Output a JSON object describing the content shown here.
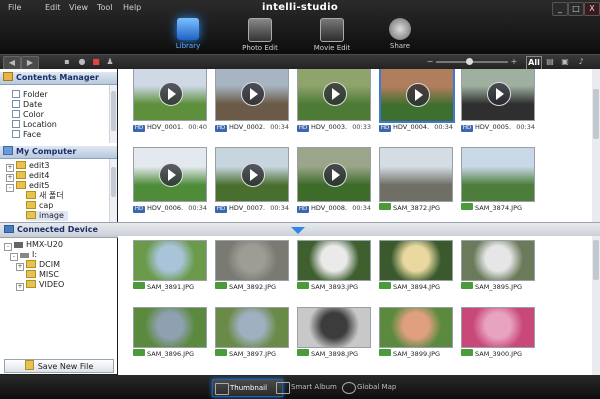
{
  "window": {
    "title": "intelli-studio",
    "min_label": "_",
    "max_label": "□",
    "close_label": "X"
  },
  "menu": [
    "File",
    "Edit",
    "View",
    "Tool",
    "Help"
  ],
  "modes": [
    {
      "label": "Library",
      "icon": "library-icon",
      "active": true
    },
    {
      "label": "Photo Edit",
      "icon": "photo-edit-icon",
      "active": false
    },
    {
      "label": "Movie Edit",
      "icon": "movie-edit-icon",
      "active": false
    },
    {
      "label": "Share",
      "icon": "share-globe-icon",
      "active": false
    }
  ],
  "toolbar": {
    "back": "◀",
    "forward": "▶",
    "zoom_minus": "−",
    "zoom_plus": "+",
    "view_all": "All"
  },
  "contents_manager": {
    "title": "Contents Manager",
    "items": [
      "Folder",
      "Date",
      "Color",
      "Location",
      "Face"
    ]
  },
  "my_computer": {
    "title": "My Computer",
    "items": [
      {
        "label": "edit3",
        "level": 1,
        "exp": "+"
      },
      {
        "label": "edit4",
        "level": 1,
        "exp": "+"
      },
      {
        "label": "edit5",
        "level": 1,
        "exp": "-"
      },
      {
        "label": "새 폴더",
        "level": 2,
        "exp": ""
      },
      {
        "label": "cap",
        "level": 2,
        "exp": ""
      },
      {
        "label": "image",
        "level": 2,
        "exp": ""
      }
    ]
  },
  "connected_device": {
    "title": "Connected Device",
    "items": [
      {
        "label": "HMX-U20",
        "level": 0,
        "exp": "-"
      },
      {
        "label": "I:",
        "level": 1,
        "exp": "-"
      },
      {
        "label": "DCIM",
        "level": 2,
        "exp": "+"
      },
      {
        "label": "MISC",
        "level": 2,
        "exp": ""
      },
      {
        "label": "VIDEO",
        "level": 2,
        "exp": "+"
      }
    ]
  },
  "save_new_file": "Save New File",
  "top_grid": [
    {
      "name": "HDV_0001.",
      "dur": "00:40",
      "type": "HD",
      "video": true,
      "sel": false,
      "c1": "#5e8f3c",
      "c2": "#cfd9e6"
    },
    {
      "name": "HDV_0002.",
      "dur": "00:34",
      "type": "HD",
      "video": true,
      "sel": false,
      "c1": "#6b5a48",
      "c2": "#a7b5c2"
    },
    {
      "name": "HDV_0003.",
      "dur": "00:33",
      "type": "HD",
      "video": true,
      "sel": false,
      "c1": "#4d7a35",
      "c2": "#8fa36d"
    },
    {
      "name": "HDV_0004.",
      "dur": "00:34",
      "type": "HD",
      "video": true,
      "sel": true,
      "c1": "#3f6f2e",
      "c2": "#b07d5d"
    },
    {
      "name": "HDV_0005.",
      "dur": "00:34",
      "type": "HD",
      "video": true,
      "sel": false,
      "c1": "#2f2f2f",
      "c2": "#9fb0a0"
    },
    {
      "name": "HDV_0006.",
      "dur": "00:34",
      "type": "HD",
      "video": true,
      "sel": false,
      "c1": "#4f8c3a",
      "c2": "#e3e9ee"
    },
    {
      "name": "HDV_0007.",
      "dur": "00:34",
      "type": "HD",
      "video": true,
      "sel": false,
      "c1": "#496f2f",
      "c2": "#c7d5df"
    },
    {
      "name": "HDV_0008.",
      "dur": "00:34",
      "type": "HD",
      "video": true,
      "sel": false,
      "c1": "#3d6b2a",
      "c2": "#9aa58a"
    },
    {
      "name": "SAM_3872.JPG",
      "dur": "",
      "type": "IMG",
      "video": false,
      "sel": false,
      "c1": "#6f6f66",
      "c2": "#d4dce4"
    },
    {
      "name": "SAM_3874.JPG",
      "dur": "",
      "type": "IMG",
      "video": false,
      "sel": false,
      "c1": "#4c7d3b",
      "c2": "#c8d8e6"
    }
  ],
  "bottom_grid": [
    {
      "name": "SAM_3891.JPG",
      "c1": "#6a9a4a",
      "c2": "#a9c3d8"
    },
    {
      "name": "SAM_3892.JPG",
      "c1": "#7a7a72",
      "c2": "#9d9d95"
    },
    {
      "name": "SAM_3893.JPG",
      "c1": "#3f5f2f",
      "c2": "#eaeaea"
    },
    {
      "name": "SAM_3894.JPG",
      "c1": "#3a5a2e",
      "c2": "#e9d9a0"
    },
    {
      "name": "SAM_3895.JPG",
      "c1": "#6a7a5a",
      "c2": "#e6e6e6"
    },
    {
      "name": "SAM_3896.JPG",
      "c1": "#5b8a3e",
      "c2": "#8fa0b0"
    },
    {
      "name": "SAM_3897.JPG",
      "c1": "#6a8a48",
      "c2": "#9fb0c0"
    },
    {
      "name": "SAM_3898.JPG",
      "c1": "#c8c8c8",
      "c2": "#3c3c3c"
    },
    {
      "name": "SAM_3899.JPG",
      "c1": "#5b8a3e",
      "c2": "#e0a080"
    },
    {
      "name": "SAM_3900.JPG",
      "c1": "#c9487a",
      "c2": "#e8a3c0"
    }
  ],
  "bottom_tabs": [
    {
      "label": "Thumbnail",
      "active": true
    },
    {
      "label": "Smart Album",
      "active": false
    },
    {
      "label": "Global Map",
      "active": false
    }
  ],
  "colors": {
    "accent": "#2a7ad8",
    "hd_badge": "#3a67b0",
    "img_badge": "#4b9a3c"
  }
}
